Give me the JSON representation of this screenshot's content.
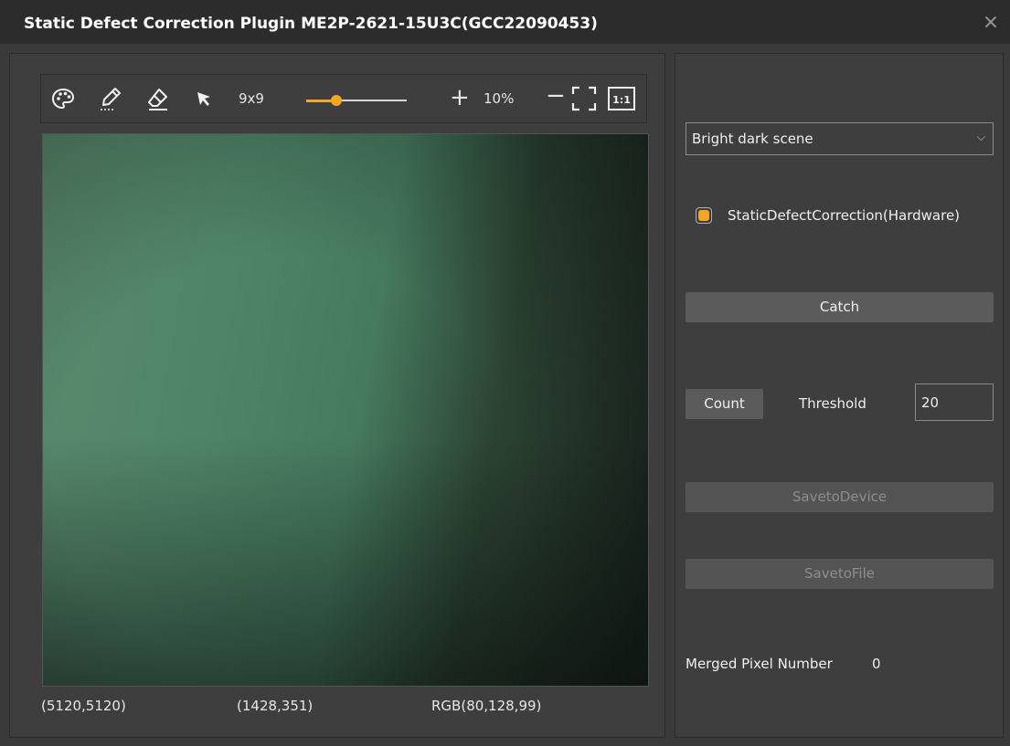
{
  "window": {
    "title": "Static Defect Correction Plugin  ME2P-2621-15U3C(GCC22090453)",
    "close_glyph": "×"
  },
  "toolbar": {
    "icons": [
      "palette-icon",
      "pencil-icon",
      "eraser-icon",
      "pointer-icon",
      "fit-screen-icon",
      "actual-size-icon"
    ],
    "brush_size": "9x9",
    "slider_level": 0.3,
    "zoom": "10%",
    "plus": "+",
    "minus": "−",
    "one_to_one": "1:1",
    "accent_color": "#f5a623"
  },
  "status": {
    "resolution": "(5120,5120)",
    "cursor": "(1428,351)",
    "rgb": "RGB(80,128,99)"
  },
  "right": {
    "scene_select": "Bright dark scene",
    "checkbox_label": "StaticDefectCorrection(Hardware)",
    "checkbox_checked": true,
    "catch_label": "Catch",
    "count_label": "Count",
    "threshold_label": "Threshold",
    "threshold_value": "20",
    "save_device_label": "SavetoDevice",
    "save_file_label": "SavetoFile",
    "merged_label": "Merged Pixel Number",
    "merged_value": "0"
  }
}
